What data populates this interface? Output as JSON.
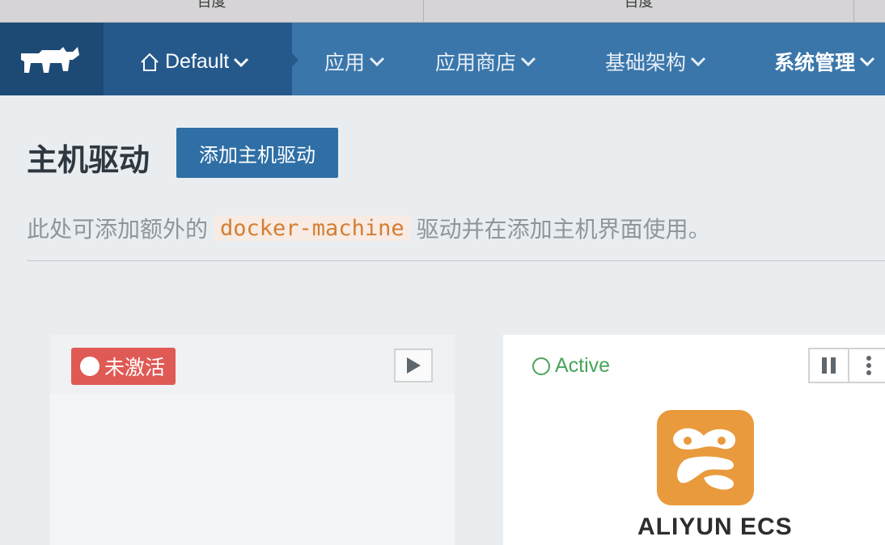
{
  "browser_tabs": [
    "百度",
    "百度"
  ],
  "nav": {
    "environment": "Default",
    "menu": [
      {
        "label": "应用"
      },
      {
        "label": "应用商店"
      },
      {
        "label": "基础架构"
      },
      {
        "label": "系统管理"
      }
    ]
  },
  "page": {
    "title": "主机驱动",
    "add_button": "添加主机驱动",
    "description_prefix": "此处可添加额外的",
    "description_code": "docker-machine",
    "description_suffix": "驱动并在添加主机界面使用。"
  },
  "drivers": [
    {
      "status": "未激活",
      "status_color": "#e05a55"
    },
    {
      "status": "Active",
      "status_color": "#48a45a",
      "name": "ALIYUN ECS"
    }
  ]
}
